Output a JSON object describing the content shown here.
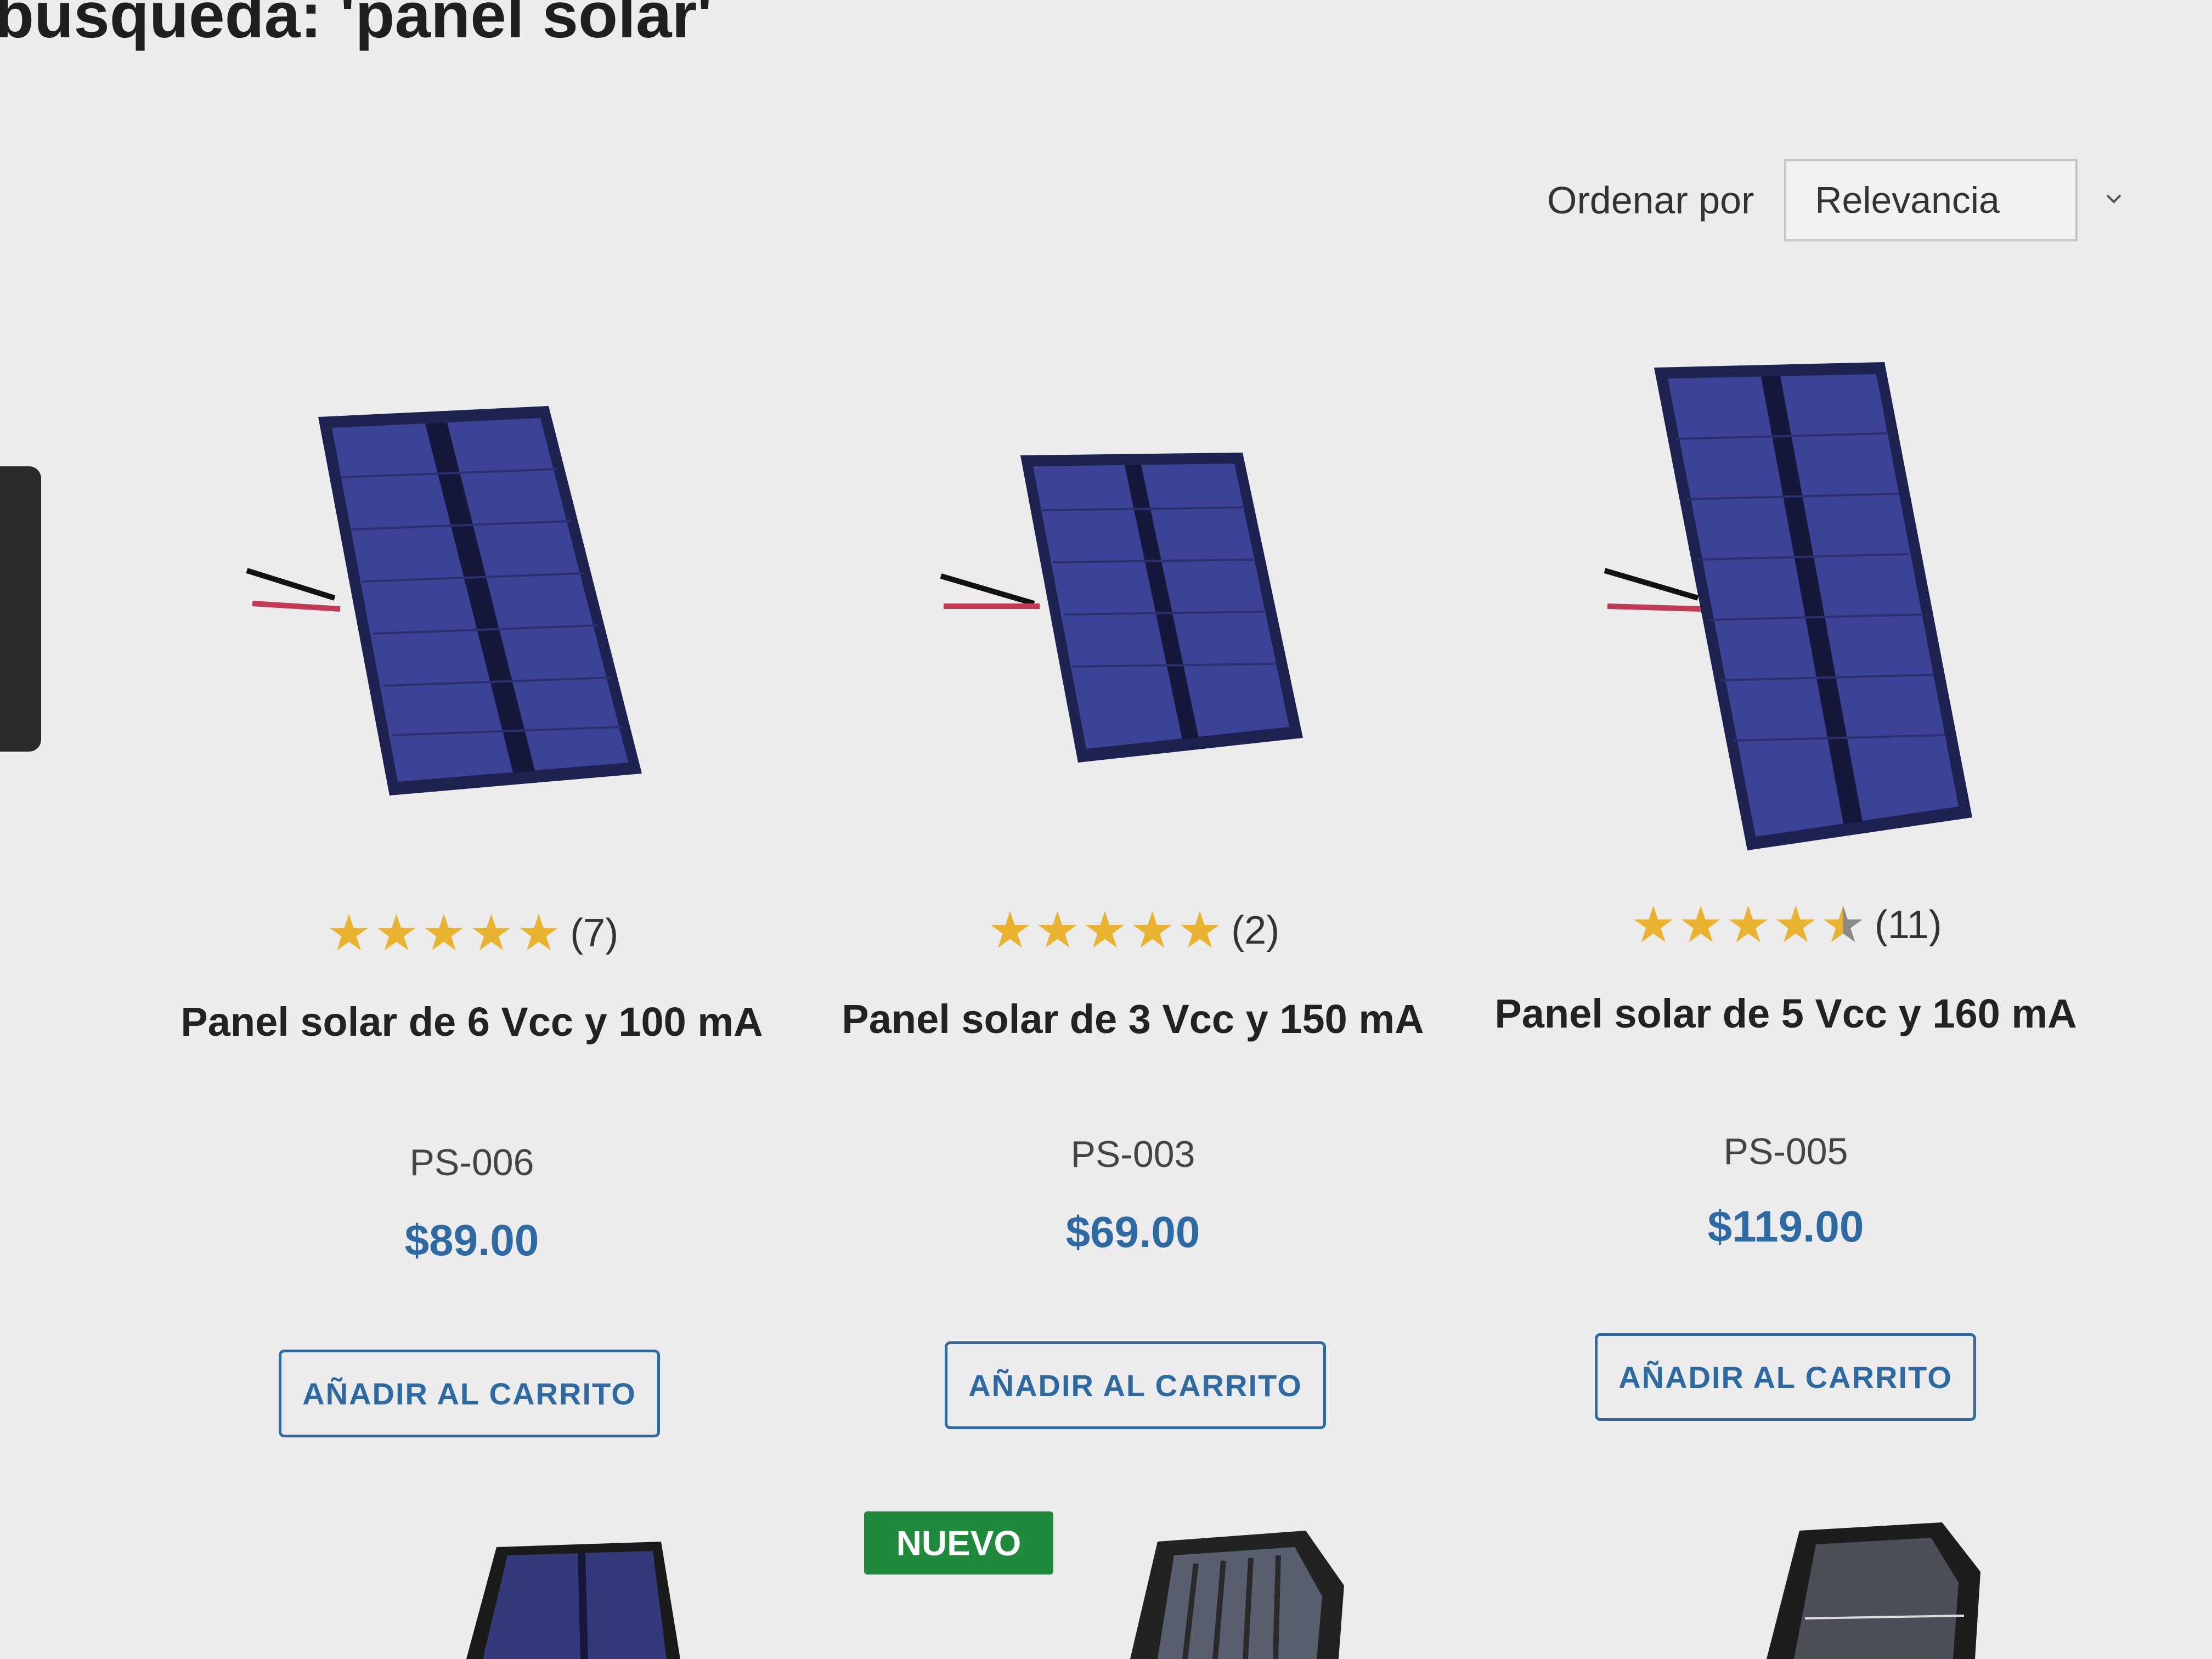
{
  "header": {
    "title": "busqueda: 'panel solar'"
  },
  "sort": {
    "label": "Ordenar por",
    "selected": "Relevancia"
  },
  "colors": {
    "accent": "#2d6aa3",
    "star": "#e9b32f",
    "badge_new": "#1f8a3c"
  },
  "products": [
    {
      "name": "Panel solar de 6 Vcc y 100 mA",
      "rating": 5,
      "review_count": "(7)",
      "sku": "PS-006",
      "price": "$89.00",
      "button": "AÑADIR AL CARRITO"
    },
    {
      "name": "Panel solar de 3 Vcc y 150 mA",
      "rating": 5,
      "review_count": "(2)",
      "sku": "PS-003",
      "price": "$69.00",
      "button": "AÑADIR AL CARRITO"
    },
    {
      "name": "Panel solar de 5 Vcc y 160 mA",
      "rating": 4.5,
      "review_count": "(11)",
      "sku": "PS-005",
      "price": "$119.00",
      "button": "AÑADIR AL CARRITO"
    }
  ],
  "next_row": {
    "badge": "NUEVO"
  }
}
